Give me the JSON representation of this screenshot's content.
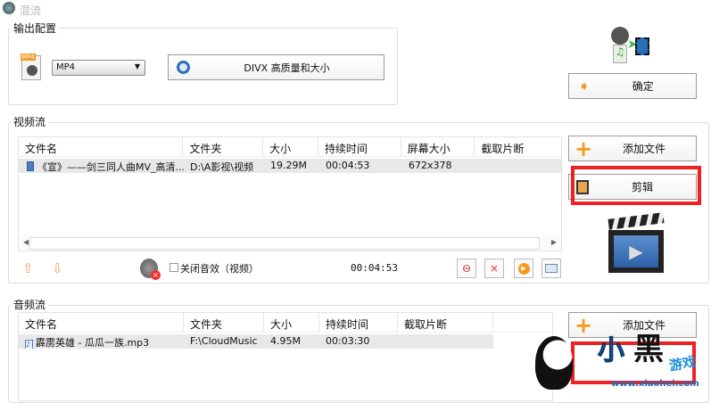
{
  "window": {
    "title": "混流"
  },
  "output_config": {
    "label": "输出配置",
    "format": "MP4",
    "format_icon_text": "MP4",
    "profile_button": "DIVX 高质量和大小"
  },
  "confirm_button": "确定",
  "video_stream": {
    "label": "视频流",
    "columns": [
      "文件名",
      "文件夹",
      "大小",
      "持续时间",
      "屏幕大小",
      "截取片断"
    ],
    "rows": [
      {
        "name": "《宣》——剑三同人曲MV_高清...",
        "folder": "D:\\A影视\\视频",
        "size": "19.29M",
        "duration": "00:04:53",
        "screen": "672x378",
        "clip": ""
      }
    ],
    "mute_label": "关闭音效（视频）",
    "total_time": "00:04:53",
    "add_file": "添加文件",
    "edit": "剪辑"
  },
  "audio_stream": {
    "label": "音频流",
    "columns": [
      "文件名",
      "文件夹",
      "大小",
      "持续时间",
      "截取片断"
    ],
    "rows": [
      {
        "name": "霹雳英雄 - 瓜瓜一族.mp3",
        "folder": "F:\\CloudMusic",
        "size": "4.95M",
        "duration": "00:03:30",
        "clip": ""
      }
    ],
    "add_file": "添加文件"
  },
  "watermark": {
    "brand": "小黑游戏",
    "url": "www.xiaohei.com"
  },
  "colors": {
    "highlight": "#ee2222",
    "orange": "#f39a1e"
  }
}
